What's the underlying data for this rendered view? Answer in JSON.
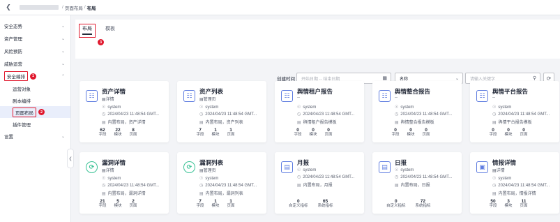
{
  "topbar": {
    "back_icon": "chevron-left-icon",
    "breadcrumb": [
      "页面布局",
      "布局"
    ]
  },
  "sidebar": {
    "items": [
      {
        "label": "安全态势"
      },
      {
        "label": "资产管理"
      },
      {
        "label": "风险预防"
      },
      {
        "label": "威胁运营"
      },
      {
        "label": "安全编排",
        "badge": "1",
        "expanded": true
      },
      {
        "label": "运营对象"
      },
      {
        "label": "剧本编排"
      },
      {
        "label": "页面布局",
        "badge": "2",
        "active": true
      },
      {
        "label": "插件管理"
      },
      {
        "label": "设置"
      }
    ]
  },
  "tabs": {
    "items": [
      "布局",
      "模板"
    ],
    "badge": "3"
  },
  "filters": {
    "created_label": "创建时间",
    "date_placeholder": "开始日期 -- 结束日期",
    "name_label": "名称",
    "keyword_placeholder": "请输入关键字"
  },
  "colors": {
    "accent": "#5e7ce0",
    "highlight": "#e0182d",
    "green": "#3ac295"
  },
  "cards": [
    {
      "title": "资产详情",
      "sub": "详情",
      "owner": "system",
      "time": "2024/04/23 11:48:54 GMT...",
      "tag": "内置布局，资产详情",
      "stats": [
        {
          "n": "62",
          "l": "字段"
        },
        {
          "n": "22",
          "l": "模块"
        },
        {
          "n": "8",
          "l": "页面"
        }
      ]
    },
    {
      "title": "资产列表",
      "sub": "管理页",
      "owner": "system",
      "time": "2024/04/23 11:48:54 GMT...",
      "tag": "内置布局，资产列表",
      "stats": [
        {
          "n": "7",
          "l": "字段"
        },
        {
          "n": "1",
          "l": "模块"
        },
        {
          "n": "1",
          "l": "页面"
        }
      ]
    },
    {
      "title": "舆情租户报告",
      "sub": "--",
      "owner": "system",
      "time": "2024/04/23 11:48:54 GMT...",
      "tag": "舆情租户报告模板",
      "stats": [
        {
          "n": "0",
          "l": "字段"
        },
        {
          "n": "0",
          "l": "模块"
        },
        {
          "n": "0",
          "l": "页面"
        }
      ]
    },
    {
      "title": "舆情整合报告",
      "sub": "--",
      "owner": "system",
      "time": "2024/04/23 11:48:54 GMT...",
      "tag": "舆情整合报告模板",
      "stats": [
        {
          "n": "0",
          "l": "字段"
        },
        {
          "n": "0",
          "l": "模块"
        },
        {
          "n": "0",
          "l": "页面"
        }
      ]
    },
    {
      "title": "舆情平台报告",
      "sub": "--",
      "owner": "system",
      "time": "2024/04/23 11:48:54 GMT...",
      "tag": "舆情平台报告模板",
      "stats": [
        {
          "n": "0",
          "l": "字段"
        },
        {
          "n": "0",
          "l": "模块"
        },
        {
          "n": "0",
          "l": "页面"
        }
      ]
    },
    {
      "title": "漏洞详情",
      "sub": "详情",
      "owner": "system",
      "time": "2024/04/23 11:48:54 GMT...",
      "tag": "内置布局，漏洞详情",
      "stats": [
        {
          "n": "21",
          "l": "字段"
        },
        {
          "n": "5",
          "l": "模块"
        },
        {
          "n": "2",
          "l": "页面"
        }
      ]
    },
    {
      "title": "漏洞列表",
      "sub": "管理页",
      "owner": "system",
      "time": "2024/04/23 11:48:54 GMT...",
      "tag": "内置布局，漏洞列表",
      "stats": [
        {
          "n": "7",
          "l": "字段"
        },
        {
          "n": "1",
          "l": "模块"
        },
        {
          "n": "1",
          "l": "页面"
        }
      ]
    },
    {
      "title": "月报",
      "sub": "",
      "owner": "system",
      "time": "2024/04/23 11:48:54 GMT...",
      "tag": "内置布局，月报",
      "stats": [
        {
          "n": "0",
          "l": "自定义指标"
        },
        {
          "n": "65",
          "l": "系统指标"
        }
      ]
    },
    {
      "title": "日报",
      "sub": "",
      "owner": "system",
      "time": "2024/04/23 11:48:54 GMT...",
      "tag": "内置布局，日报",
      "stats": [
        {
          "n": "0",
          "l": "自定义指标"
        },
        {
          "n": "72",
          "l": "系统指标"
        }
      ]
    },
    {
      "title": "情报详情",
      "sub": "详情",
      "owner": "system",
      "time": "2024/04/23 11:48:54 GMT...",
      "tag": "内置布局，情报详情",
      "stats": [
        {
          "n": "50",
          "l": "字段"
        },
        {
          "n": "3",
          "l": "模块"
        },
        {
          "n": "11",
          "l": "页面"
        }
      ]
    }
  ]
}
